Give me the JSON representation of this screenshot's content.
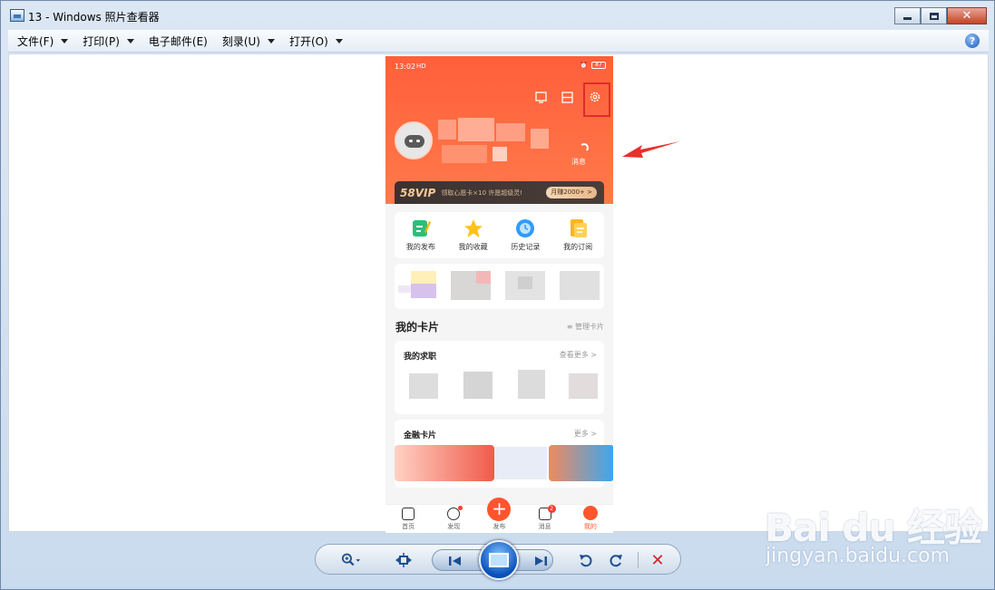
{
  "window": {
    "title": "13 - Windows 照片查看器",
    "close_glyph": "✕"
  },
  "menu": {
    "items": [
      {
        "label": "文件(F)"
      },
      {
        "label": "打印(P)"
      },
      {
        "label": "电子邮件(E)"
      },
      {
        "label": "刻录(U)"
      },
      {
        "label": "打开(O)"
      }
    ],
    "help_glyph": "?"
  },
  "phone": {
    "status_time": "13:02",
    "status_signal": "HD",
    "battery": "87",
    "message_label": "消息",
    "vip": {
      "logo": "58VIP",
      "text": "领取心愿卡×10 许愿超级灵!",
      "pill": "月赚2000+ >"
    },
    "quick_actions": [
      {
        "label": "我的发布",
        "icon": "publish-icon",
        "color": "#2bbf7a"
      },
      {
        "label": "我的收藏",
        "icon": "star-icon",
        "color": "#ffc21a"
      },
      {
        "label": "历史记录",
        "icon": "clock-icon",
        "color": "#2f9bff"
      },
      {
        "label": "我的订阅",
        "icon": "subscribe-icon",
        "color": "#ffb323"
      }
    ],
    "cards_section": {
      "title": "我的卡片",
      "link": "≡ 管理卡片"
    },
    "jobs_card": {
      "title": "我的求职",
      "more": "查看更多 >"
    },
    "finance_card": {
      "title": "金融卡片",
      "more": "更多 >"
    },
    "tabs": [
      {
        "label": "首页",
        "active": false
      },
      {
        "label": "发现",
        "active": false,
        "badge": "dot"
      },
      {
        "label": "发布",
        "active": false
      },
      {
        "label": "消息",
        "active": false,
        "badge": "2"
      },
      {
        "label": "我的",
        "active": true
      }
    ],
    "publish_glyph": "+",
    "accent": "#ff552e"
  },
  "controls": {
    "delete_glyph": "✕"
  },
  "watermark": {
    "main": "Bai du 经验",
    "sub": "jingyan.baidu.com"
  }
}
